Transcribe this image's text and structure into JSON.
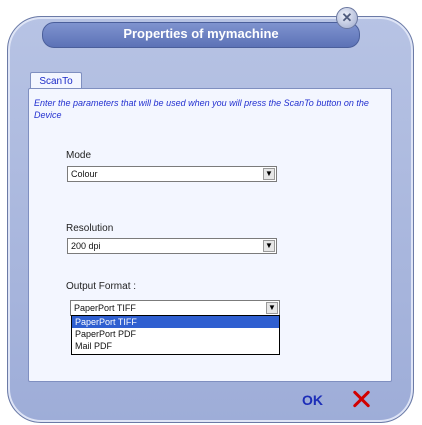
{
  "window": {
    "title": "Properties of mymachine"
  },
  "tabs": [
    {
      "label": "ScanTo"
    }
  ],
  "instruction": "Enter the parameters that will be used when you will press the ScanTo button on the Device",
  "mode": {
    "label": "Mode",
    "value": "Colour"
  },
  "resolution": {
    "label": "Resolution",
    "value": "200 dpi"
  },
  "output_format": {
    "label": "Output Format :",
    "value": "PaperPort TIFF",
    "options": [
      "PaperPort TIFF",
      "PaperPort PDF",
      "Mail PDF"
    ]
  },
  "buttons": {
    "ok": "OK"
  },
  "colors": {
    "title_bar": "#6a80c4",
    "instruction_text": "#2330d0",
    "selected_option": "#2f5fd0",
    "cancel": "#d10000"
  }
}
